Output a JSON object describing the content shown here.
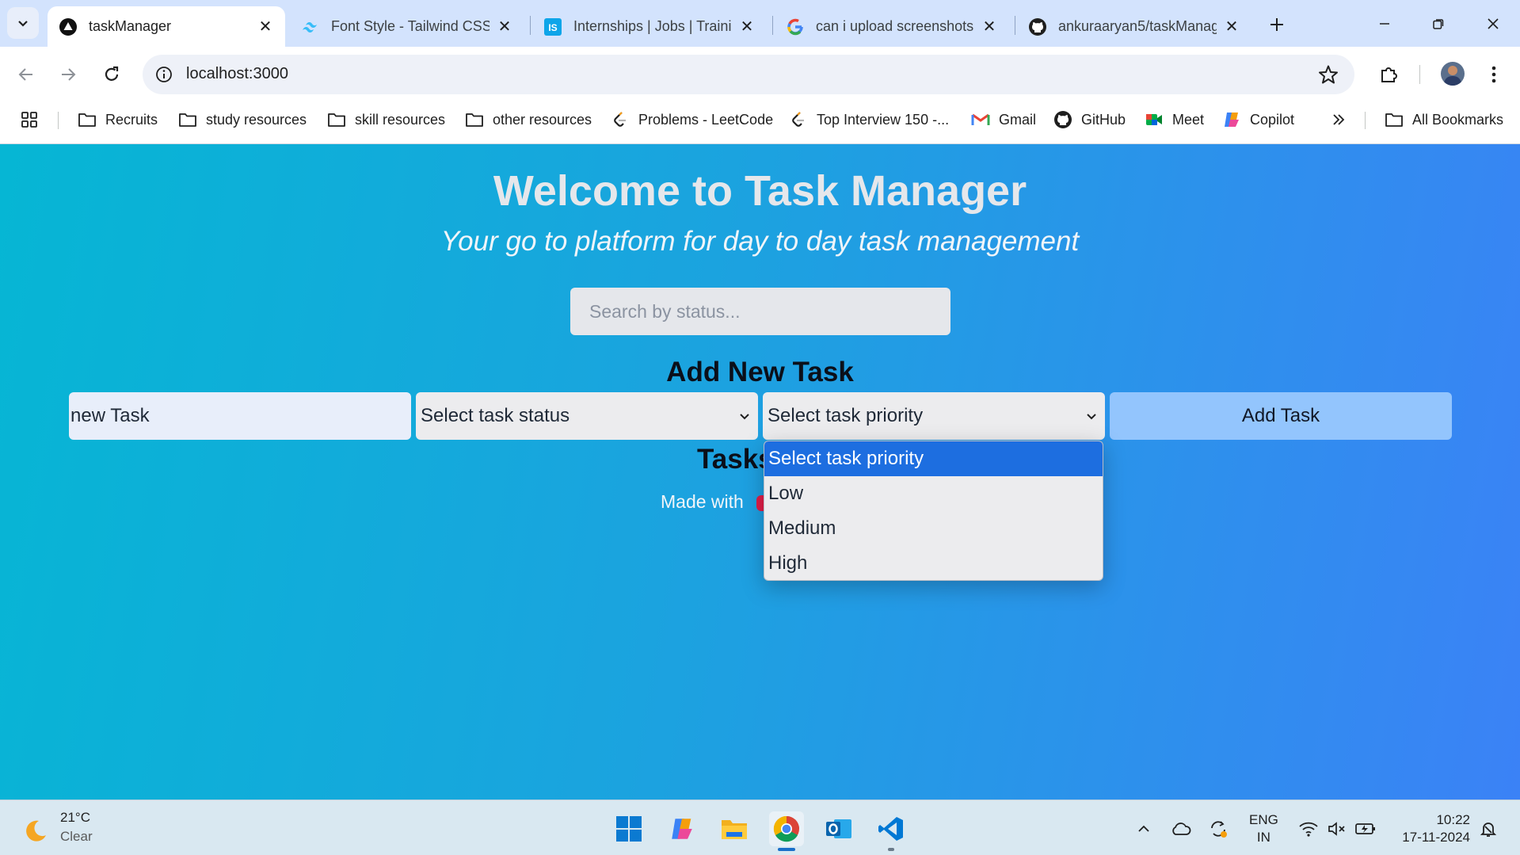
{
  "browser": {
    "tabs": [
      {
        "title": "taskManager",
        "icon": "nextjs-icon",
        "active": true
      },
      {
        "title": "Font Style - Tailwind CSS",
        "icon": "tailwind-icon",
        "active": false
      },
      {
        "title": "Internships | Jobs | Traini",
        "icon": "internshala-icon",
        "active": false
      },
      {
        "title": "can i upload screenshots",
        "icon": "google-icon",
        "active": false
      },
      {
        "title": "ankuraaryan5/taskManag",
        "icon": "github-icon",
        "active": false
      }
    ],
    "url": "localhost:3000",
    "bookmarks": [
      {
        "label": "Recruits",
        "icon": "folder-icon"
      },
      {
        "label": "study resources",
        "icon": "folder-icon"
      },
      {
        "label": "skill resources",
        "icon": "folder-icon"
      },
      {
        "label": "other resources",
        "icon": "folder-icon"
      },
      {
        "label": "Problems - LeetCode",
        "icon": "leetcode-icon"
      },
      {
        "label": "Top Interview 150 -...",
        "icon": "leetcode-icon"
      },
      {
        "label": "Gmail",
        "icon": "gmail-icon"
      },
      {
        "label": "GitHub",
        "icon": "github-icon"
      },
      {
        "label": "Meet",
        "icon": "meet-icon"
      },
      {
        "label": "Copilot",
        "icon": "copilot-icon"
      }
    ],
    "all_bookmarks": "All Bookmarks"
  },
  "app": {
    "title": "Welcome to Task Manager",
    "tagline": "Your go to platform for day to day task management",
    "search_placeholder": "Search by status...",
    "add_heading": "Add New Task",
    "task_input_value": "new Task",
    "status_select": "Select task status",
    "priority_select": "Select task priority",
    "add_button": "Add Task",
    "tasks_heading": "Tasks",
    "footer": "Made with",
    "priority_options": [
      "Select task priority",
      "Low",
      "Medium",
      "High"
    ],
    "highlighted_option": "Select task priority"
  },
  "taskbar": {
    "temperature": "21°C",
    "condition": "Clear",
    "language": "ENG",
    "region": "IN",
    "time": "10:22",
    "date": "17-11-2024"
  },
  "colors": {
    "gradient_start": "#06b6d4",
    "gradient_end": "#3b82f6",
    "add_button_bg": "#93c5fd",
    "option_highlight": "#1d6ee0"
  }
}
